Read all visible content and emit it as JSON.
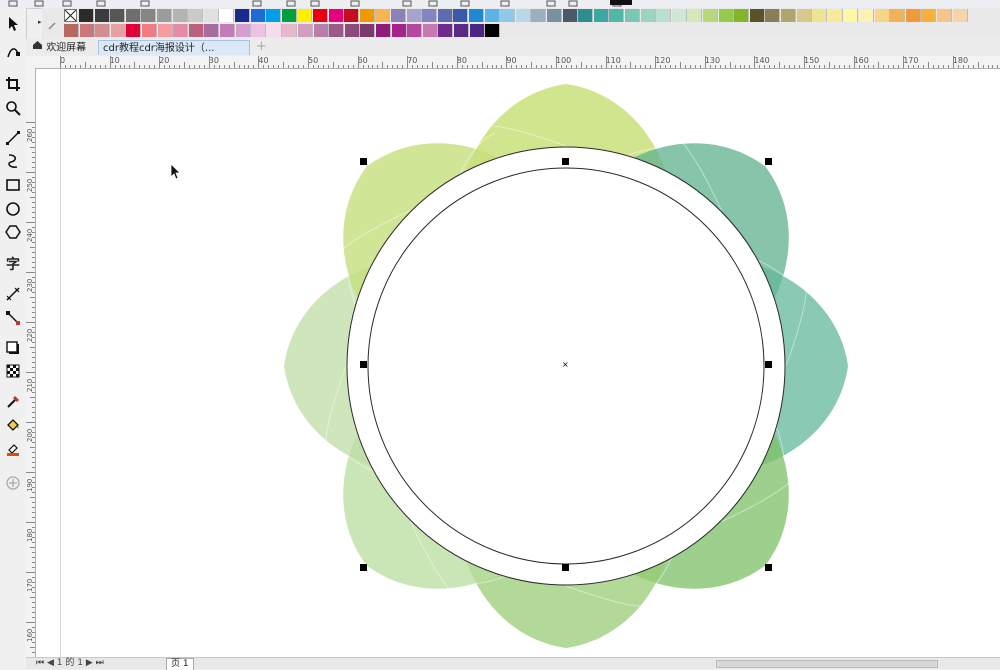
{
  "toolbar_top": {
    "icons": [
      "new-icon",
      "open-icon",
      "save-icon",
      "undo-icon",
      "zoom-icon",
      "snap-icon",
      "options-icon",
      "launch-icon"
    ]
  },
  "palette": {
    "row1": [
      "#2b2b2b",
      "#3c3c3c",
      "#565656",
      "#6e6e6e",
      "#858585",
      "#9c9c9c",
      "#b3b3b3",
      "#cacaca",
      "#e0e0e0",
      "#ffffff",
      "#1b2a8e",
      "#1e6bd6",
      "#00a0e9",
      "#00a040",
      "#fff100",
      "#e60012",
      "#e4007f",
      "#c30d23",
      "#f39800",
      "#f8b551",
      "#8b82b8",
      "#a7a3cc",
      "#8484c0",
      "#5d6cb0",
      "#3a5aa8",
      "#1e88d0",
      "#5ab4e5",
      "#8fc8e8",
      "#b7d7ea",
      "#9ab0c0",
      "#7890a0",
      "#4a5a68",
      "#2e8d90",
      "#3aa9a3",
      "#51b8a5",
      "#7cc7b4",
      "#9dd3c1",
      "#b8dfcf",
      "#cfe7d6",
      "#d6e8b9",
      "#b8d77c",
      "#99c84e",
      "#83b52b",
      "#5c5228",
      "#8a7e58",
      "#b2a46e",
      "#d6c98a",
      "#ede391",
      "#f7eb9b",
      "#fff7a8",
      "#fef1b2",
      "#f6d48a",
      "#f0b357",
      "#f29b36",
      "#f6b03c",
      "#f7c58b",
      "#f7d3a9"
    ],
    "row2": [
      "#b86660",
      "#c9787a",
      "#d28e90",
      "#e6a1a3",
      "#e3003a",
      "#f07c82",
      "#f59ca0",
      "#e58ba5",
      "#bb6180",
      "#a96aa0",
      "#c47cb8",
      "#d69ed0",
      "#ecc1e3",
      "#f7dcea",
      "#e7b8cd",
      "#d29ec0",
      "#ba7eab",
      "#9c5a88",
      "#8c4a7d",
      "#7a3b6c",
      "#8d1d79",
      "#a5238b",
      "#b6479c",
      "#c679b3",
      "#6e2a8d",
      "#5c2a86",
      "#4b2583",
      "#000000"
    ]
  },
  "tabs": {
    "welcome": "欢迎屏幕",
    "document": "cdr教程cdr海报设计（..."
  },
  "ruler_h": [
    "0",
    "10",
    "20",
    "30",
    "40",
    "50",
    "60",
    "70",
    "80",
    "90",
    "100",
    "110",
    "120",
    "130",
    "140",
    "150",
    "160",
    "170",
    "180"
  ],
  "ruler_v": [
    "260",
    "250",
    "240",
    "230",
    "220",
    "210",
    "200",
    "190",
    "180",
    "170",
    "160"
  ],
  "tools": [
    "pick-tool-icon",
    "shape-tool-icon",
    "crop-tool-icon",
    "zoom-tool-icon",
    "freehand-tool-icon",
    "artistic-media-icon",
    "rectangle-tool-icon",
    "ellipse-tool-icon",
    "polygon-tool-icon",
    "text-tool-icon",
    "parallel-dimension-icon",
    "connector-tool-icon",
    "drop-shadow-icon",
    "transparency-icon",
    "eyedropper-icon",
    "interactive-fill-icon",
    "smart-fill-icon",
    "add-tool-icon"
  ],
  "status": {
    "page_count": "1 的 1",
    "page_label": "页 1"
  }
}
